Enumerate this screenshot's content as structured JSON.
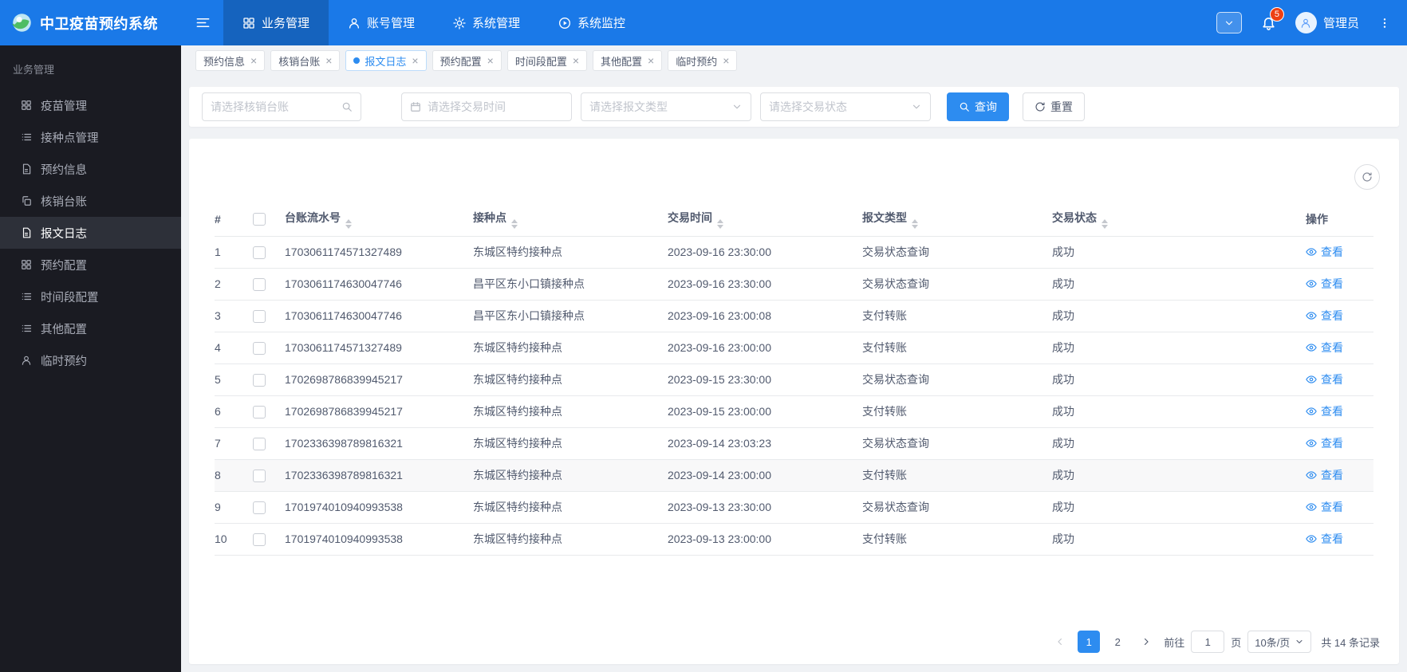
{
  "colors": {
    "primary": "#2d8cf0",
    "header_bg": "#1a79e8",
    "sidebar_bg": "#1a1b22",
    "danger": "#ed4014",
    "page_bg": "#f0f2f5"
  },
  "app": {
    "title": "中卫疫苗预约系统",
    "nav": [
      {
        "label": "业务管理",
        "icon": "grid-icon",
        "active": true
      },
      {
        "label": "账号管理",
        "icon": "user-icon",
        "active": false
      },
      {
        "label": "系统管理",
        "icon": "gear-icon",
        "active": false
      },
      {
        "label": "系统监控",
        "icon": "monitor-icon",
        "active": false
      }
    ],
    "user": {
      "name": "管理员",
      "notification_count": "5"
    }
  },
  "sidebar": {
    "section": "业务管理",
    "items": [
      {
        "label": "疫苗管理",
        "icon": "grid-icon",
        "active": false
      },
      {
        "label": "接种点管理",
        "icon": "list-icon",
        "active": false
      },
      {
        "label": "预约信息",
        "icon": "file-icon",
        "active": false
      },
      {
        "label": "核销台账",
        "icon": "copy-icon",
        "active": false
      },
      {
        "label": "报文日志",
        "icon": "file-icon",
        "active": true
      },
      {
        "label": "预约配置",
        "icon": "grid-icon",
        "active": false
      },
      {
        "label": "时间段配置",
        "icon": "list-icon",
        "active": false
      },
      {
        "label": "其他配置",
        "icon": "list-icon",
        "active": false
      },
      {
        "label": "临时预约",
        "icon": "user-icon",
        "active": false
      }
    ]
  },
  "tabs": [
    {
      "label": "预约信息",
      "active": false
    },
    {
      "label": "核销台账",
      "active": false
    },
    {
      "label": "报文日志",
      "active": true
    },
    {
      "label": "预约配置",
      "active": false
    },
    {
      "label": "时间段配置",
      "active": false
    },
    {
      "label": "其他配置",
      "active": false
    },
    {
      "label": "临时预约",
      "active": false
    }
  ],
  "filters": {
    "ledger_placeholder": "请选择核销台账",
    "time_placeholder": "请选择交易时间",
    "type_placeholder": "请选择报文类型",
    "status_placeholder": "请选择交易状态",
    "search_label": "查询",
    "reset_label": "重置"
  },
  "table": {
    "columns": [
      "#",
      "台账流水号",
      "接种点",
      "交易时间",
      "报文类型",
      "交易状态",
      "操作"
    ],
    "action_label": "查看",
    "rows": [
      {
        "index": "1",
        "serial": "1703061174571327489",
        "site": "东城区特约接种点",
        "time": "2023-09-16 23:30:00",
        "type": "交易状态查询",
        "status": "成功"
      },
      {
        "index": "2",
        "serial": "1703061174630047746",
        "site": "昌平区东小口镇接种点",
        "time": "2023-09-16 23:30:00",
        "type": "交易状态查询",
        "status": "成功"
      },
      {
        "index": "3",
        "serial": "1703061174630047746",
        "site": "昌平区东小口镇接种点",
        "time": "2023-09-16 23:00:08",
        "type": "支付转账",
        "status": "成功"
      },
      {
        "index": "4",
        "serial": "1703061174571327489",
        "site": "东城区特约接种点",
        "time": "2023-09-16 23:00:00",
        "type": "支付转账",
        "status": "成功"
      },
      {
        "index": "5",
        "serial": "1702698786839945217",
        "site": "东城区特约接种点",
        "time": "2023-09-15 23:30:00",
        "type": "交易状态查询",
        "status": "成功"
      },
      {
        "index": "6",
        "serial": "1702698786839945217",
        "site": "东城区特约接种点",
        "time": "2023-09-15 23:00:00",
        "type": "支付转账",
        "status": "成功"
      },
      {
        "index": "7",
        "serial": "1702336398789816321",
        "site": "东城区特约接种点",
        "time": "2023-09-14 23:03:23",
        "type": "交易状态查询",
        "status": "成功"
      },
      {
        "index": "8",
        "serial": "1702336398789816321",
        "site": "东城区特约接种点",
        "time": "2023-09-14 23:00:00",
        "type": "支付转账",
        "status": "成功"
      },
      {
        "index": "9",
        "serial": "1701974010940993538",
        "site": "东城区特约接种点",
        "time": "2023-09-13 23:30:00",
        "type": "交易状态查询",
        "status": "成功"
      },
      {
        "index": "10",
        "serial": "1701974010940993538",
        "site": "东城区特约接种点",
        "time": "2023-09-13 23:00:00",
        "type": "支付转账",
        "status": "成功"
      }
    ]
  },
  "pagination": {
    "pages": [
      "1",
      "2"
    ],
    "active_page": "1",
    "goto_label": "前往",
    "goto_value": "1",
    "page_unit": "页",
    "page_size": "10条/页",
    "total": "共 14 条记录"
  }
}
